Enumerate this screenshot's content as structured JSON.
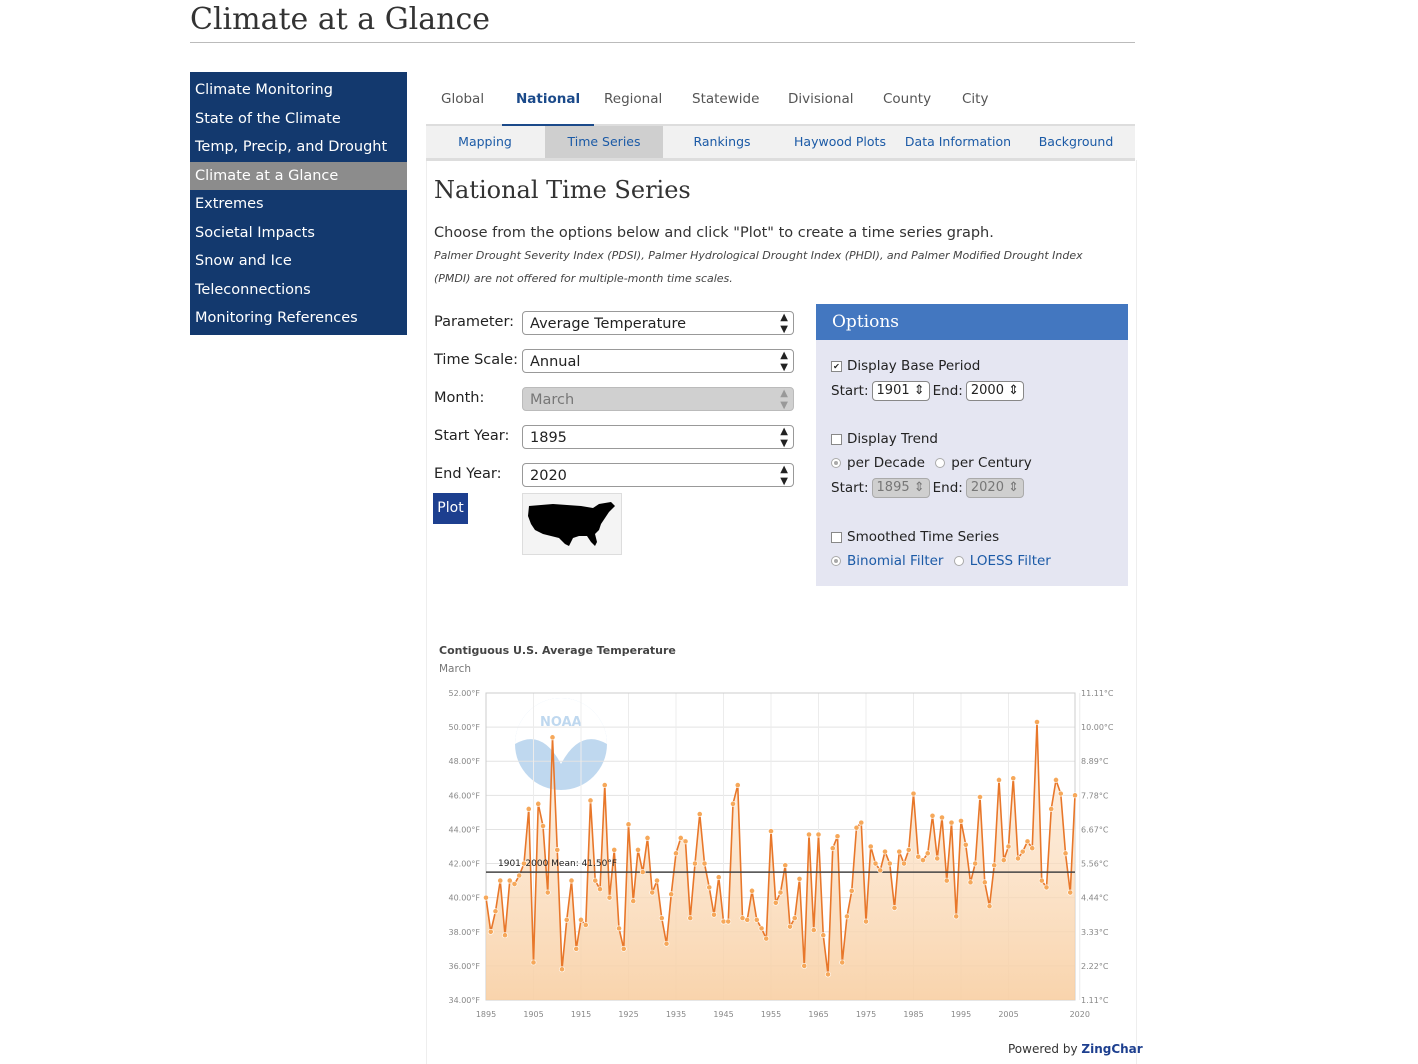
{
  "page": {
    "title": "Climate at a Glance"
  },
  "sidebar": {
    "items": [
      {
        "label": "Climate Monitoring",
        "active": false
      },
      {
        "label": "State of the Climate",
        "active": false
      },
      {
        "label": "Temp, Precip, and Drought",
        "active": false
      },
      {
        "label": "Climate at a Glance",
        "active": true
      },
      {
        "label": "Extremes",
        "active": false
      },
      {
        "label": "Societal Impacts",
        "active": false
      },
      {
        "label": "Snow and Ice",
        "active": false
      },
      {
        "label": "Teleconnections",
        "active": false
      },
      {
        "label": "Monitoring References",
        "active": false
      }
    ]
  },
  "tabs": {
    "items": [
      "Global",
      "National",
      "Regional",
      "Statewide",
      "Divisional",
      "County",
      "City"
    ],
    "active": "National"
  },
  "subtabs": {
    "items": [
      "Mapping",
      "Time Series",
      "Rankings",
      "Haywood Plots",
      "Data Information",
      "Background"
    ],
    "active": "Time Series"
  },
  "main": {
    "heading": "National Time Series",
    "intro": "Choose from the options below and click \"Plot\" to create a time series graph.",
    "note_line1": "Palmer Drought Severity Index (PDSI), Palmer Hydrological Drought Index (PHDI), and Palmer Modified Drought Index",
    "note_line2": "(PMDI) are not offered for multiple-month time scales."
  },
  "form": {
    "parameter_label": "Parameter:",
    "parameter_value": "Average Temperature",
    "timescale_label": "Time Scale:",
    "timescale_value": "Annual",
    "month_label": "Month:",
    "month_value": "March",
    "start_label": "Start Year:",
    "start_value": "1895",
    "end_label": "End Year:",
    "end_value": "2020",
    "plot_label": "Plot"
  },
  "options": {
    "title": "Options",
    "base_period_label": "Display Base Period",
    "base_period_checked": true,
    "start_label": "Start:",
    "end_label": "End:",
    "base_start": "1901",
    "base_end": "2000",
    "trend_label": "Display Trend",
    "trend_checked": false,
    "per_decade": "per Decade",
    "per_century": "per Century",
    "trend_start": "1895",
    "trend_end": "2020",
    "smoothed_label": "Smoothed Time Series",
    "smoothed_checked": false,
    "binomial": "Binomial Filter",
    "loess": "LOESS Filter"
  },
  "colors": {
    "sidebar": "#13396e",
    "accent": "#1b4a8a",
    "series": "#e8772a",
    "fill": "#f8cfa3",
    "options_head": "#4377c0"
  },
  "chart_data": {
    "type": "area",
    "title": "Contiguous U.S. Average Temperature",
    "subtitle": "March",
    "ylim": [
      34,
      52
    ],
    "yticks_left": [
      "34.00°F",
      "36.00°F",
      "38.00°F",
      "40.00°F",
      "42.00°F",
      "44.00°F",
      "46.00°F",
      "48.00°F",
      "50.00°F",
      "52.00°F"
    ],
    "yticks_right": [
      "1.11°C",
      "2.22°C",
      "3.33°C",
      "4.44°C",
      "5.56°C",
      "6.67°C",
      "7.78°C",
      "8.89°C",
      "10.00°C",
      "11.11°C"
    ],
    "xticks": [
      "1895",
      "1905",
      "1915",
      "1925",
      "1935",
      "1945",
      "1955",
      "1965",
      "1975",
      "1985",
      "1995",
      "2005",
      "2020"
    ],
    "mean_label": "1901–2000 Mean: 41.50°F",
    "mean": 41.5,
    "start_year": 1895,
    "values": [
      40.0,
      38.0,
      39.2,
      41.0,
      37.8,
      41.0,
      40.8,
      41.3,
      42.0,
      45.2,
      36.2,
      45.5,
      44.2,
      40.3,
      49.4,
      42.8,
      35.8,
      38.7,
      41.0,
      37.0,
      38.7,
      38.4,
      45.7,
      41.0,
      40.5,
      46.6,
      40.0,
      42.8,
      38.2,
      37.0,
      44.3,
      39.8,
      42.8,
      41.5,
      43.5,
      40.3,
      41.0,
      38.8,
      37.3,
      40.2,
      42.6,
      43.5,
      43.3,
      38.8,
      42.0,
      44.9,
      42.0,
      40.6,
      39.0,
      41.2,
      38.6,
      38.6,
      45.5,
      46.6,
      38.8,
      38.7,
      40.4,
      38.7,
      38.2,
      37.6,
      43.9,
      39.7,
      40.3,
      41.9,
      38.3,
      38.8,
      41.1,
      36.0,
      43.7,
      38.1,
      43.7,
      37.8,
      35.5,
      42.9,
      43.6,
      36.2,
      38.9,
      40.4,
      44.1,
      44.4,
      38.6,
      43.0,
      42.0,
      41.6,
      42.7,
      42.0,
      39.4,
      42.7,
      42.0,
      42.8,
      46.1,
      42.4,
      42.2,
      42.6,
      44.8,
      42.3,
      44.7,
      41.0,
      44.4,
      38.9,
      44.5,
      43.1,
      40.9,
      42.0,
      45.9,
      40.9,
      39.5,
      41.9,
      46.9,
      42.2,
      43.0,
      47.0,
      42.3,
      42.7,
      43.3,
      42.9,
      50.3,
      41.0,
      40.6,
      45.2,
      46.9,
      46.1,
      42.6,
      40.3,
      46.0
    ]
  }
}
